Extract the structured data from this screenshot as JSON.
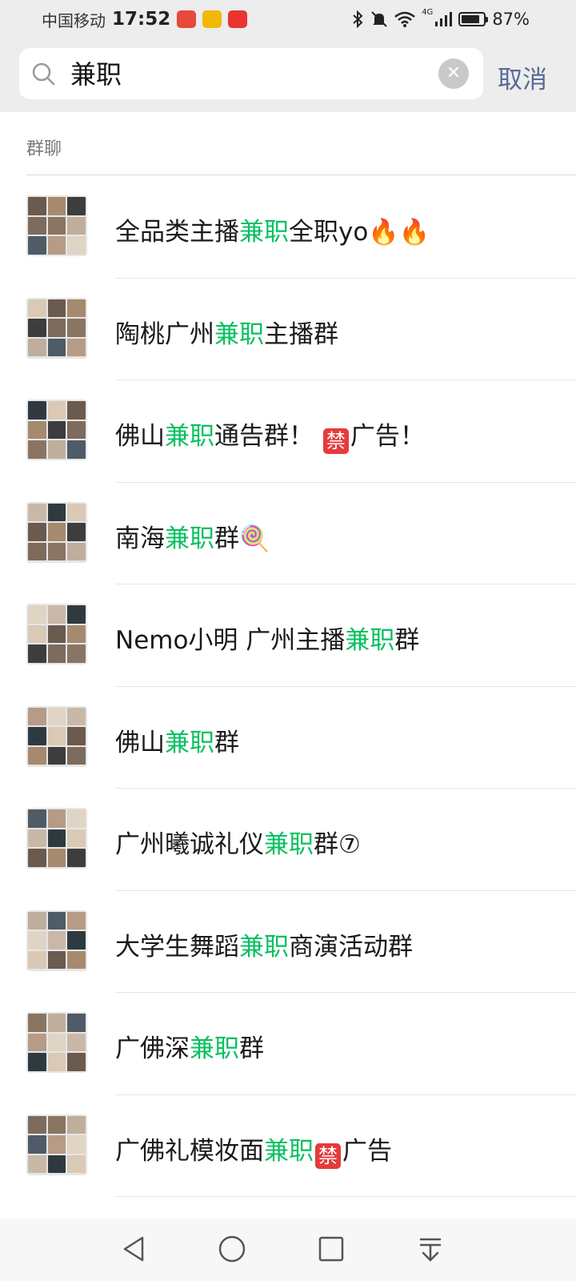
{
  "status_bar": {
    "carrier": "中国移动",
    "time": "17:52",
    "network": "4G",
    "battery": "87%",
    "battery_level": 0.87
  },
  "search": {
    "query": "兼职",
    "cancel_label": "取消"
  },
  "section": {
    "title": "群聊"
  },
  "groups": [
    {
      "pre": "全品类主播",
      "kw": "兼职",
      "post": "全职yo🔥🔥",
      "ban": "",
      "post2": ""
    },
    {
      "pre": "陶桃广州",
      "kw": "兼职",
      "post": "主播群",
      "ban": "",
      "post2": ""
    },
    {
      "pre": "佛山",
      "kw": "兼职",
      "post": "通告群！ ",
      "ban": "禁",
      "post2": "广告！"
    },
    {
      "pre": "南海",
      "kw": "兼职",
      "post": "群🍭",
      "ban": "",
      "post2": ""
    },
    {
      "pre": "Nemo小明 广州主播",
      "kw": "兼职",
      "post": "群",
      "ban": "",
      "post2": ""
    },
    {
      "pre": "佛山",
      "kw": "兼职",
      "post": "群",
      "ban": "",
      "post2": ""
    },
    {
      "pre": "广州曦诚礼仪",
      "kw": "兼职",
      "post": "群⑦",
      "ban": "",
      "post2": ""
    },
    {
      "pre": "大学生舞蹈",
      "kw": "兼职",
      "post": "商演活动群",
      "ban": "",
      "post2": ""
    },
    {
      "pre": "广佛深",
      "kw": "兼职",
      "post": "群",
      "ban": "",
      "post2": ""
    },
    {
      "pre": "广佛礼模妆面",
      "kw": "兼职",
      "post": "",
      "ban": "禁",
      "post2": "广告"
    }
  ],
  "colors": {
    "highlight": "#07c160",
    "link": "#576b95",
    "ban_badge": "#e53b3b"
  }
}
